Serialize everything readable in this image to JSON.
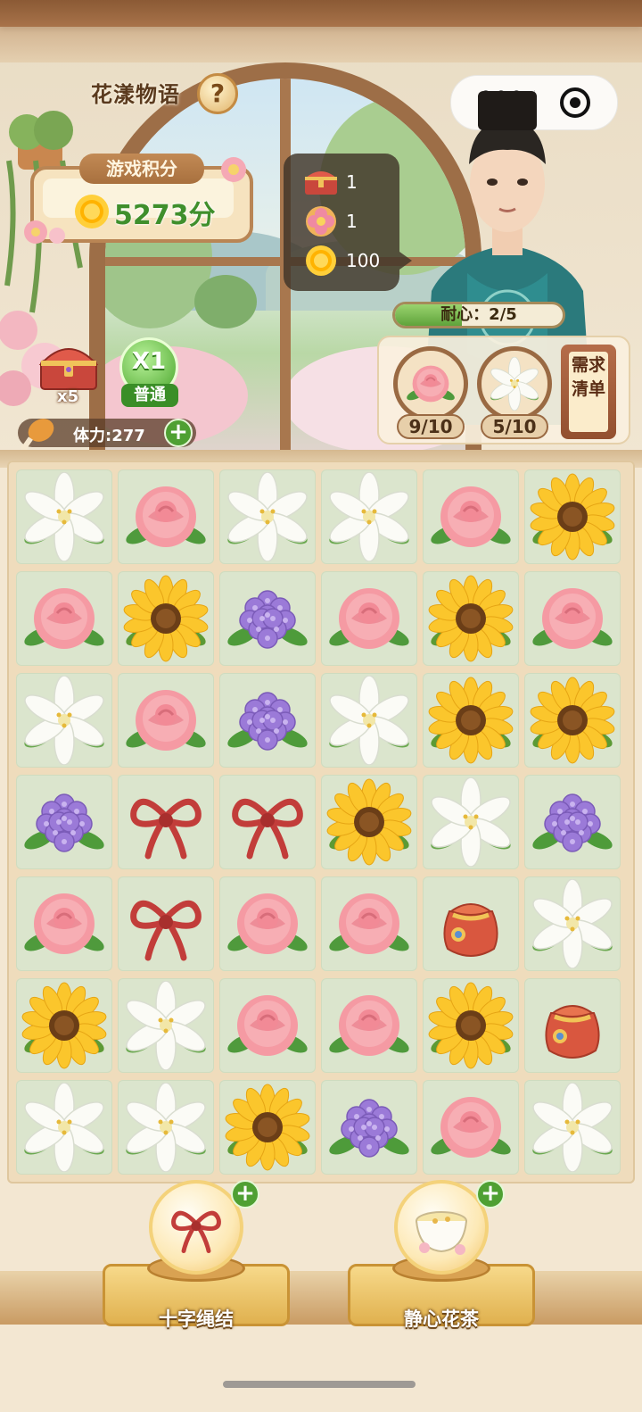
{
  "game": {
    "title": "花漾物语",
    "help_glyph": "?"
  },
  "capsule": {
    "more_glyph": "•••"
  },
  "score": {
    "label": "游戏积分",
    "value": "5273分"
  },
  "rewards": [
    {
      "icon": "treasure-chest-icon",
      "value": "1"
    },
    {
      "icon": "flower-token-icon",
      "value": "1"
    },
    {
      "icon": "sun-coin-icon",
      "value": "100"
    }
  ],
  "customer": {
    "patience_label": "耐心：2/5",
    "patience_fraction": 0.4
  },
  "demand": {
    "items": [
      {
        "flower": "rose",
        "count": "9/10"
      },
      {
        "flower": "lily",
        "count": "5/10"
      }
    ],
    "list_label": "需求清单"
  },
  "chest": {
    "multiplier": "x5"
  },
  "speed": {
    "value": "X1",
    "label": "普通"
  },
  "energy": {
    "label": "体力:277",
    "add_glyph": "+"
  },
  "board": {
    "cols": 6,
    "rows": 7,
    "tiles": [
      [
        "lily",
        "rose",
        "lily",
        "lily",
        "rose",
        "sunflower"
      ],
      [
        "rose",
        "sunflower",
        "hydrangea",
        "rose",
        "sunflower",
        "rose"
      ],
      [
        "lily",
        "rose",
        "hydrangea",
        "lily",
        "sunflower",
        "sunflower"
      ],
      [
        "hydrangea",
        "knot",
        "knot",
        "sunflower",
        "lily",
        "hydrangea"
      ],
      [
        "rose",
        "knot",
        "rose",
        "rose",
        "pouch",
        "lily"
      ],
      [
        "sunflower",
        "lily",
        "rose",
        "rose",
        "sunflower",
        "pouch"
      ],
      [
        "lily",
        "lily",
        "sunflower",
        "hydrangea",
        "rose",
        "lily"
      ]
    ]
  },
  "tools": [
    {
      "name": "cross-knot",
      "label": "十字绳结",
      "add_glyph": "+"
    },
    {
      "name": "calm-tea",
      "label": "静心花茶",
      "add_glyph": "+"
    }
  ],
  "colors": {
    "accent_green": "#3f8f2c",
    "wood": "#9a6a43",
    "tile": "#dbe5cd"
  }
}
